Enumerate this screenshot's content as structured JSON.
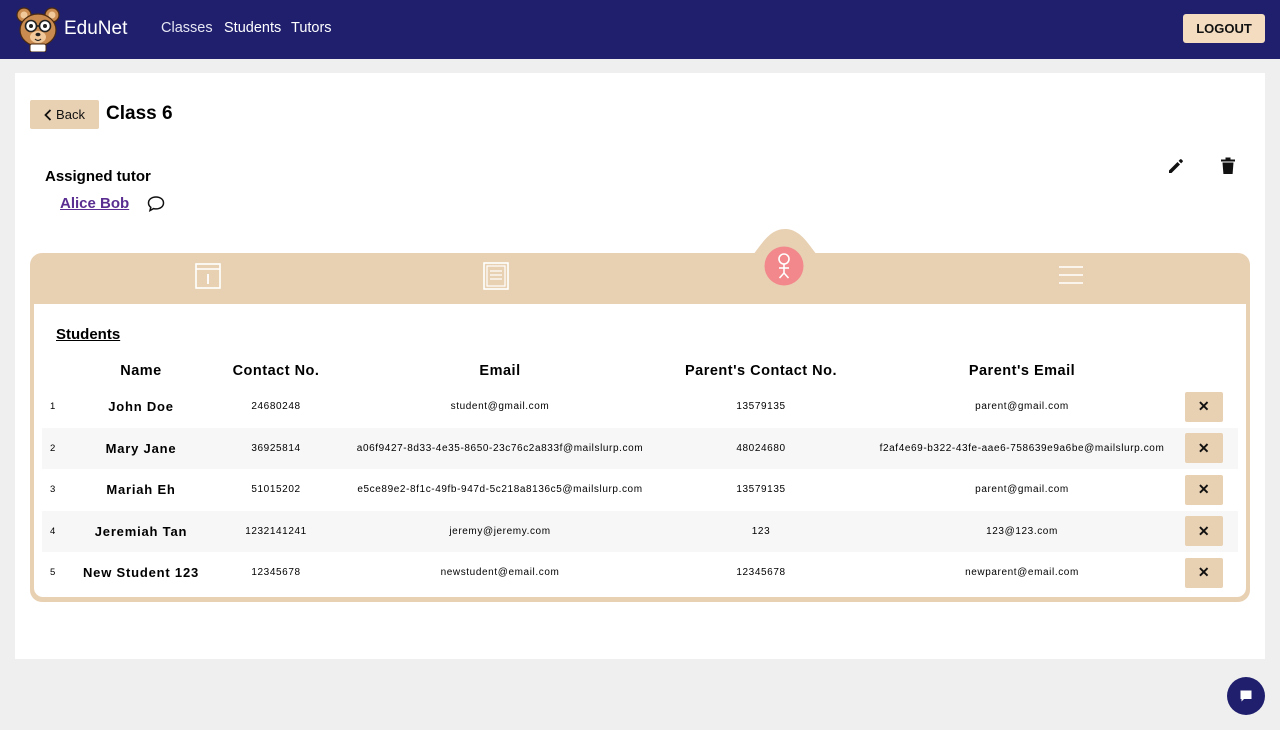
{
  "nav": {
    "brand": "EduNet",
    "links": [
      "Classes",
      "Students",
      "Tutors"
    ],
    "logout_label": "LOGOUT"
  },
  "page": {
    "back_label": "Back",
    "title": "Class 6",
    "tutor_heading": "Assigned tutor",
    "tutor_name": "Alice Bob"
  },
  "tabs": {
    "active_index": 2,
    "icons": [
      "class-info-icon",
      "notebook-icon",
      "student-icon",
      "menu-icon"
    ]
  },
  "students": {
    "heading": "Students",
    "columns": [
      "",
      "Name",
      "Contact No.",
      "Email",
      "Parent's Contact No.",
      "Parent's Email",
      ""
    ],
    "rows": [
      {
        "index": "1",
        "name": "John Doe",
        "contact": "24680248",
        "email": "student@gmail.com",
        "parent_contact": "13579135",
        "parent_email": "parent@gmail.com"
      },
      {
        "index": "2",
        "name": "Mary Jane",
        "contact": "36925814",
        "email": "a06f9427-8d33-4e35-8650-23c76c2a833f@mailslurp.com",
        "parent_contact": "48024680",
        "parent_email": "f2af4e69-b322-43fe-aae6-758639e9a6be@mailslurp.com"
      },
      {
        "index": "3",
        "name": "Mariah Eh",
        "contact": "51015202",
        "email": "e5ce89e2-8f1c-49fb-947d-5c218a8136c5@mailslurp.com",
        "parent_contact": "13579135",
        "parent_email": "parent@gmail.com"
      },
      {
        "index": "4",
        "name": "Jeremiah Tan",
        "contact": "1232141241",
        "email": "jeremy@jeremy.com",
        "parent_contact": "123",
        "parent_email": "123@123.com"
      },
      {
        "index": "5",
        "name": "New Student 123",
        "contact": "12345678",
        "email": "newstudent@email.com",
        "parent_contact": "12345678",
        "parent_email": "newparent@email.com"
      }
    ],
    "delete_glyph": "✕"
  },
  "colors": {
    "nav_bg": "#1f1f6e",
    "accent_tan": "#e8d0b2",
    "active_tab": "#f2888c",
    "link_purple": "#5a2d91"
  }
}
